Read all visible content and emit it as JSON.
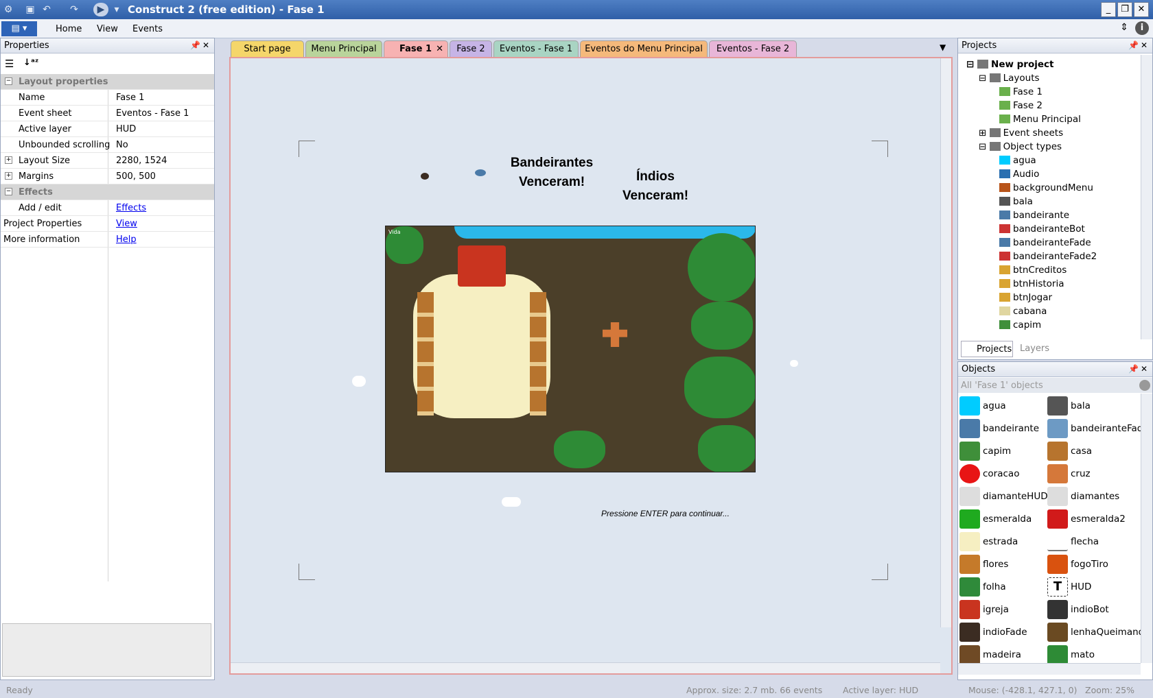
{
  "window": {
    "title": "Construct 2 (free edition) - Fase 1"
  },
  "ribbon": {
    "tabs": [
      "Home",
      "View",
      "Events"
    ]
  },
  "properties": {
    "header": "Properties",
    "category": "Layout properties",
    "rows": [
      {
        "key": "Name",
        "value": "Fase 1"
      },
      {
        "key": "Event sheet",
        "value": "Eventos - Fase 1"
      },
      {
        "key": "Active layer",
        "value": "HUD"
      },
      {
        "key": "Unbounded scrolling",
        "value": "No"
      },
      {
        "key": "Layout Size",
        "value": "2280, 1524"
      },
      {
        "key": "Margins",
        "value": "500, 500"
      }
    ],
    "effects_category": "Effects",
    "add_edit": {
      "key": "Add / edit",
      "value": "Effects"
    },
    "project_properties": {
      "key": "Project Properties",
      "value": "View"
    },
    "more_information": {
      "key": "More information",
      "value": "Help"
    }
  },
  "tabs": [
    {
      "label": "Start page",
      "color": "#f5d66a"
    },
    {
      "label": "Menu Principal",
      "color": "#b9d49b"
    },
    {
      "label": "Fase 1",
      "color": "#f7b2b2"
    },
    {
      "label": "Fase 2",
      "color": "#c6b4e6"
    },
    {
      "label": "Eventos - Fase 1",
      "color": "#a9d4c3"
    },
    {
      "label": "Eventos do Menu Principal",
      "color": "#f5b97b"
    },
    {
      "label": "Eventos - Fase 2",
      "color": "#e8b6d8"
    }
  ],
  "canvas": {
    "text_bandeirantes": "Bandeirantes\nVenceram!",
    "text_indios": "Índios\nVenceram!",
    "text_continue": "Pressione ENTER para continuar...",
    "hud_label": "Vida"
  },
  "projects": {
    "header": "Projects",
    "root": "New project",
    "layouts_label": "Layouts",
    "layouts": [
      "Fase 1",
      "Fase 2",
      "Menu Principal"
    ],
    "event_sheets_label": "Event sheets",
    "object_types_label": "Object types",
    "object_types": [
      "agua",
      "Audio",
      "backgroundMenu",
      "bala",
      "bandeirante",
      "bandeiranteBot",
      "bandeiranteFade",
      "bandeiranteFade2",
      "btnCreditos",
      "btnHistoria",
      "btnJogar",
      "cabana",
      "capim"
    ],
    "bottom_tabs": [
      "Projects",
      "Layers"
    ]
  },
  "objects": {
    "header": "Objects",
    "filter": "All 'Fase 1' objects",
    "items": [
      {
        "name": "agua",
        "color": "#00ccff"
      },
      {
        "name": "bala",
        "color": "#555555"
      },
      {
        "name": "bandeirante",
        "color": "#4a7aa8"
      },
      {
        "name": "bandeiranteFade",
        "color": "#6d9ac4"
      },
      {
        "name": "capim",
        "color": "#3f8f3a"
      },
      {
        "name": "casa",
        "color": "#b7742e"
      },
      {
        "name": "coracao",
        "color": "#e81515"
      },
      {
        "name": "cruz",
        "color": "#d5783a"
      },
      {
        "name": "diamanteHUD",
        "color": "#dddddd"
      },
      {
        "name": "diamantes",
        "color": "#dddddd"
      },
      {
        "name": "esmeralda",
        "color": "#1faa1f"
      },
      {
        "name": "esmeralda2",
        "color": "#d11a1a"
      },
      {
        "name": "estrada",
        "color": "#f6efc2"
      },
      {
        "name": "flecha",
        "color": "#777777"
      },
      {
        "name": "flores",
        "color": "#c57a2a"
      },
      {
        "name": "fogoTiro",
        "color": "#d9520f"
      },
      {
        "name": "folha",
        "color": "#2f8a3a"
      },
      {
        "name": "HUD",
        "color": "#ffffff"
      },
      {
        "name": "igreja",
        "color": "#c9341f"
      },
      {
        "name": "indioBot",
        "color": "#333333"
      },
      {
        "name": "indioFade",
        "color": "#3b2c22"
      },
      {
        "name": "lenhaQueimando",
        "color": "#6a4a22"
      },
      {
        "name": "madeira",
        "color": "#6f4a25"
      },
      {
        "name": "mato",
        "color": "#2e8b36"
      }
    ]
  },
  "status": {
    "ready": "Ready",
    "size": "Approx. size: 2.7 mb. 66 events",
    "layer": "Active layer: HUD",
    "mouse": "Mouse: (-428.1, 427.1, 0)",
    "zoom": "Zoom: 25%"
  }
}
